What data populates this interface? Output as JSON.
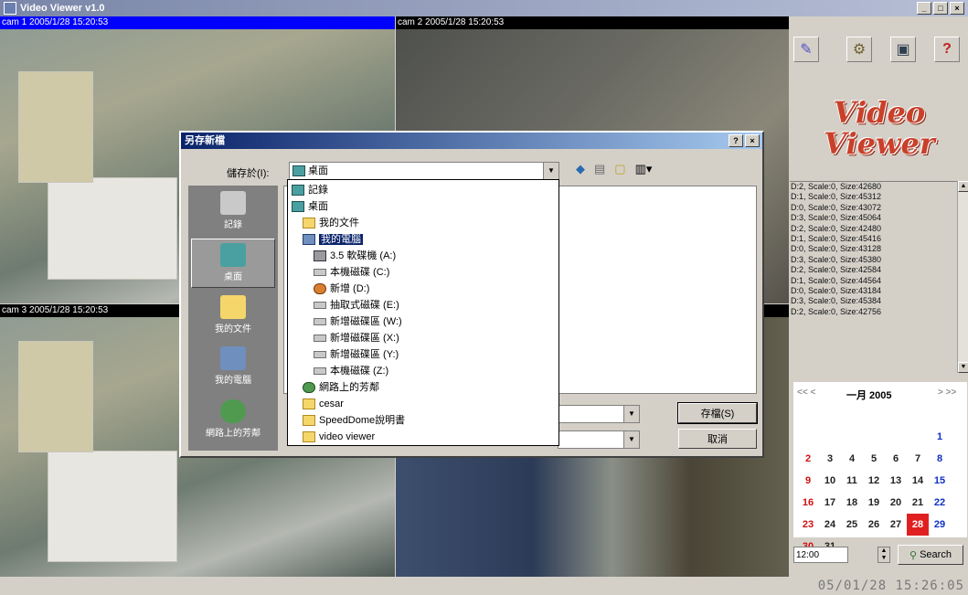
{
  "window": {
    "title": "Video Viewer v1.0",
    "buttons": [
      "_",
      "□",
      "×"
    ]
  },
  "cameras": [
    {
      "label": "cam 1 2005/1/28 15:20:53",
      "label_bg": "#0000ff"
    },
    {
      "label": "cam 2 2005/1/28 15:20:53",
      "label_bg": "#000000"
    },
    {
      "label": "cam 3 2005/1/28 15:20:53",
      "label_bg": "#000000"
    },
    {
      "label": "",
      "label_bg": "#000000"
    }
  ],
  "toolbar": [
    "edit-icon",
    "settings-icon",
    "camera-icon",
    "help-icon"
  ],
  "logo": {
    "line1": "Video",
    "line2": "Viewer"
  },
  "log_lines": [
    "D:2, Scale:0, Size:42680",
    "D:1, Scale:0, Size:45312",
    "D:0, Scale:0, Size:43072",
    "D:3, Scale:0, Size:45064",
    "D:2, Scale:0, Size:42480",
    "D:1, Scale:0, Size:45416",
    "D:0, Scale:0, Size:43128",
    "D:3, Scale:0, Size:45380",
    "D:2, Scale:0, Size:42584",
    "D:1, Scale:0, Size:44564",
    "D:0, Scale:0, Size:43184",
    "D:3, Scale:0, Size:45384",
    "D:2, Scale:0, Size:42756"
  ],
  "calendar": {
    "prev": "<< <",
    "next": "> >>",
    "month": "一月 2005",
    "weeks": [
      [
        "",
        "",
        "",
        "",
        "",
        "",
        "1"
      ],
      [
        "2",
        "3",
        "4",
        "5",
        "6",
        "7",
        "8"
      ],
      [
        "9",
        "10",
        "11",
        "12",
        "13",
        "14",
        "15"
      ],
      [
        "16",
        "17",
        "18",
        "19",
        "20",
        "21",
        "22"
      ],
      [
        "23",
        "24",
        "25",
        "26",
        "27",
        "28",
        "29"
      ],
      [
        "30",
        "31",
        "",
        "",
        "",
        "",
        ""
      ]
    ],
    "selected": "28",
    "selected_color": "#e02020"
  },
  "time_value": "12:00",
  "search_label": "Search",
  "status_clock": "05/01/28 15:26:05",
  "dialog": {
    "title": "另存新檔",
    "title_buttons": [
      "?",
      "×"
    ],
    "save_in_label": "儲存於(I):",
    "save_in_value": "桌面",
    "places": [
      "記錄",
      "桌面",
      "我的文件",
      "我的電腦",
      "網路上的芳鄰"
    ],
    "dropdown_items": [
      {
        "label": "記錄",
        "icon": "desk",
        "indent": 0
      },
      {
        "label": "桌面",
        "icon": "desk",
        "indent": 0
      },
      {
        "label": "我的文件",
        "icon": "folder",
        "indent": 1
      },
      {
        "label": "我的電腦",
        "icon": "pc",
        "indent": 1,
        "selected": true
      },
      {
        "label": "3.5 軟碟機 (A:)",
        "icon": "floppy",
        "indent": 2
      },
      {
        "label": "本機磁碟 (C:)",
        "icon": "drive",
        "indent": 2
      },
      {
        "label": "新增 (D:)",
        "icon": "cd",
        "indent": 2
      },
      {
        "label": "抽取式磁碟 (E:)",
        "icon": "drive",
        "indent": 2
      },
      {
        "label": "新增磁碟區 (W:)",
        "icon": "drive",
        "indent": 2
      },
      {
        "label": "新增磁碟區 (X:)",
        "icon": "drive",
        "indent": 2
      },
      {
        "label": "新增磁碟區 (Y:)",
        "icon": "drive",
        "indent": 2
      },
      {
        "label": "本機磁碟 (Z:)",
        "icon": "drive",
        "indent": 2
      },
      {
        "label": "網路上的芳鄰",
        "icon": "net",
        "indent": 1
      },
      {
        "label": "cesar",
        "icon": "folder",
        "indent": 1
      },
      {
        "label": "SpeedDome說明書",
        "icon": "folder",
        "indent": 1
      },
      {
        "label": "video viewer",
        "icon": "folder",
        "indent": 1
      }
    ],
    "save_button": "存檔(S)",
    "cancel_button": "取消"
  }
}
